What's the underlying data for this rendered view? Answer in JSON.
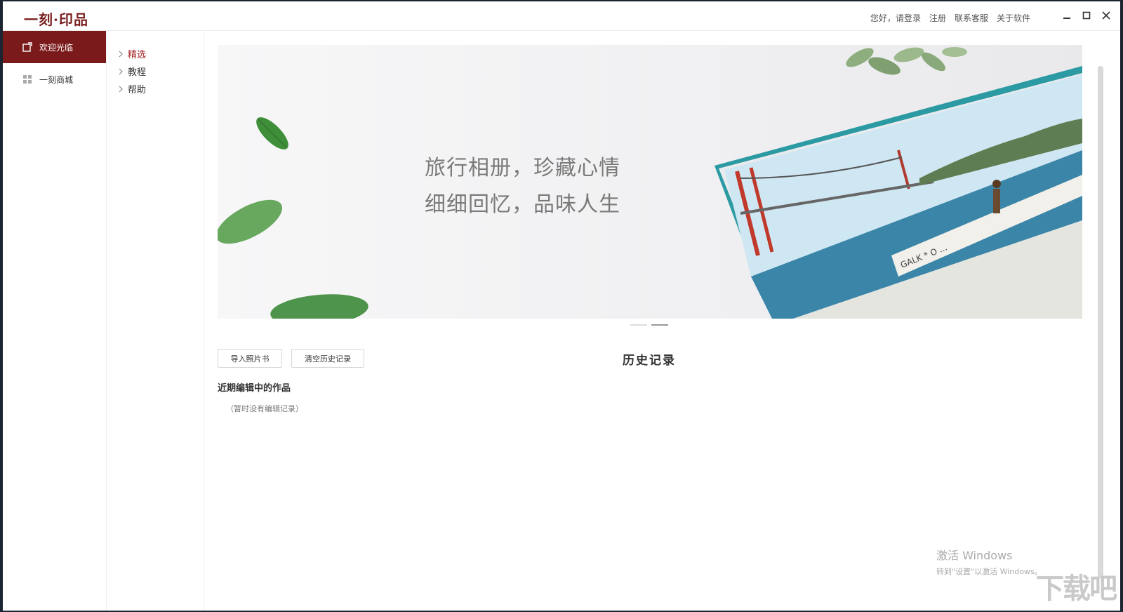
{
  "app": {
    "logo": "一刻·印品"
  },
  "top_links": [
    "您好，请登录",
    "注册",
    "联系客服",
    "关于软件"
  ],
  "window_controls": {
    "minimize": "minimize-icon",
    "maximize": "maximize-icon",
    "close": "close-icon"
  },
  "left_nav": [
    {
      "label": "欢迎光临",
      "icon": "welcome-icon",
      "active": true
    },
    {
      "label": "一刻商城",
      "icon": "grid-icon",
      "active": false
    }
  ],
  "sub_nav": [
    {
      "label": "精选",
      "active": true
    },
    {
      "label": "教程",
      "active": false
    },
    {
      "label": "帮助",
      "active": false
    }
  ],
  "banner": {
    "line1": "旅行相册，珍藏心情",
    "line2": "细细回忆，品味人生",
    "slide_count": 2,
    "active_slide": 2
  },
  "actions": {
    "import": "导入照片书",
    "clear": "清空历史记录"
  },
  "history": {
    "title": "历史记录",
    "recent_label": "近期编辑中的作品",
    "empty_text": "（暂时没有编辑记录）"
  },
  "system": {
    "activation_line1": "激活 Windows",
    "activation_line2": "转到\"设置\"以激活 Windows。",
    "watermark": "下载吧"
  },
  "colors": {
    "brand": "#7a1a1a",
    "accent_text": "#a32020"
  }
}
